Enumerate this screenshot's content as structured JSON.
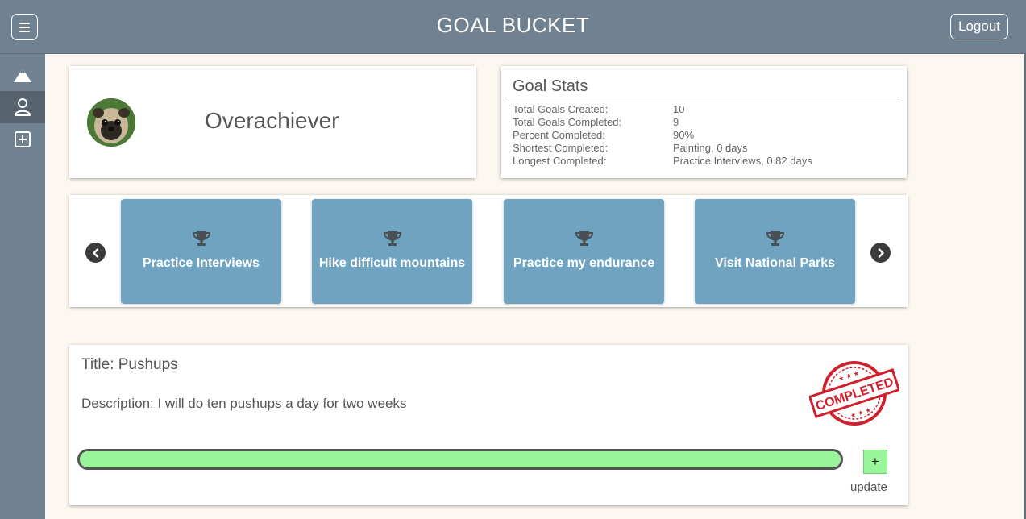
{
  "header": {
    "title": "GOAL BUCKET",
    "logout_label": "Logout"
  },
  "sidebar": {
    "items": [
      {
        "icon": "mountain-icon"
      },
      {
        "icon": "user-icon",
        "active": true
      },
      {
        "icon": "plus-square-icon"
      }
    ]
  },
  "profile": {
    "username": "Overachiever",
    "avatar": "pug-avatar"
  },
  "stats": {
    "title": "Goal Stats",
    "rows": [
      {
        "label": "Total Goals Created:",
        "value": "10"
      },
      {
        "label": "Total Goals Completed:",
        "value": "9"
      },
      {
        "label": "Percent Completed:",
        "value": "90%"
      },
      {
        "label": "Shortest Completed:",
        "value": "Painting, 0 days"
      },
      {
        "label": "Longest Completed:",
        "value": "Practice Interviews, 0.82 days"
      }
    ]
  },
  "carousel": {
    "goals": [
      {
        "label": "Practice Interviews"
      },
      {
        "label": "Hike difficult mountains"
      },
      {
        "label": "Practice my endurance"
      },
      {
        "label": "Visit National Parks"
      }
    ]
  },
  "detail": {
    "title": "Title: Pushups",
    "description": "Description: I will do ten pushups a day for two weeks",
    "progress": 1.0,
    "plus_label": "+",
    "update_label": "update",
    "stamp_text": "COMPLETED"
  },
  "colors": {
    "header_bg": "#708191",
    "sidebar_active": "#57636f",
    "page_bg": "#fcf7f0",
    "tile_bg": "#6fa3bf",
    "progress_fill": "#98f59a",
    "stamp_red": "#d0202e"
  }
}
